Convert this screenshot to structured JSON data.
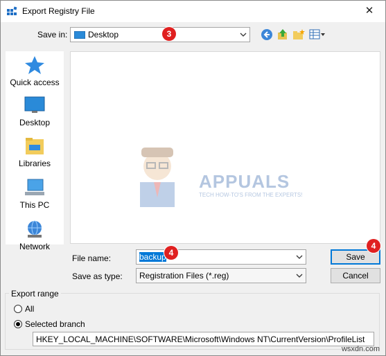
{
  "window": {
    "title": "Export Registry File",
    "close_glyph": "✕"
  },
  "save_in": {
    "label": "Save in:",
    "value": "Desktop",
    "badge": "3"
  },
  "toolbar": {
    "icons": [
      "back-icon",
      "up-folder-icon",
      "new-folder-icon",
      "view-menu-icon"
    ]
  },
  "places": [
    {
      "label": "Quick access",
      "icon": "star-icon"
    },
    {
      "label": "Desktop",
      "icon": "desktop-icon"
    },
    {
      "label": "Libraries",
      "icon": "libraries-icon"
    },
    {
      "label": "This PC",
      "icon": "computer-icon"
    },
    {
      "label": "Network",
      "icon": "network-icon"
    }
  ],
  "watermark": {
    "text": "APPUALS",
    "tagline": "TECH HOW-TO'S FROM THE EXPERTS!"
  },
  "file_name": {
    "label": "File name:",
    "value": "backup",
    "badge": "4"
  },
  "save_as_type": {
    "label": "Save as type:",
    "value": "Registration Files (*.reg)"
  },
  "buttons": {
    "save": "Save",
    "save_badge": "4",
    "cancel": "Cancel"
  },
  "export_range": {
    "title": "Export range",
    "all_label": "All",
    "selected_label": "Selected branch",
    "selected": "selected_branch",
    "branch_path": "HKEY_LOCAL_MACHINE\\SOFTWARE\\Microsoft\\Windows NT\\CurrentVersion\\ProfileList"
  },
  "footer": "wsxdn.com",
  "colors": {
    "accent": "#0078d7",
    "badge": "#e02020"
  }
}
